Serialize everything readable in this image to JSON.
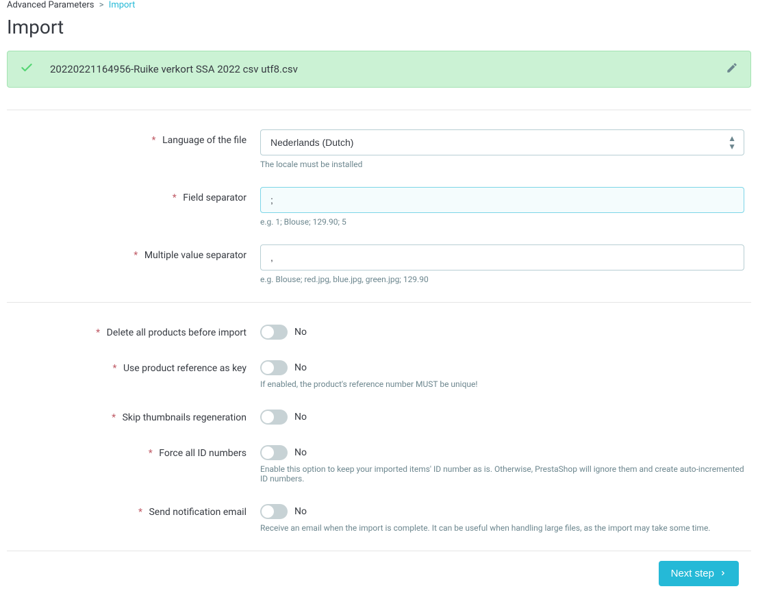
{
  "breadcrumb": {
    "parent": "Advanced Parameters",
    "current": "Import"
  },
  "page_title": "Import",
  "file": {
    "name": "20220221164956-Ruike verkort SSA 2022 csv utf8.csv"
  },
  "form": {
    "language": {
      "label": "Language of the file",
      "value": "Nederlands (Dutch)",
      "help": "The locale must be installed"
    },
    "field_separator": {
      "label": "Field separator",
      "value": ";",
      "help": "e.g. 1; Blouse; 129.90; 5"
    },
    "multi_separator": {
      "label": "Multiple value separator",
      "value": ",",
      "help": "e.g. Blouse; red.jpg, blue.jpg, green.jpg; 129.90"
    },
    "delete_products": {
      "label": "Delete all products before import",
      "state": "No"
    },
    "use_reference": {
      "label": "Use product reference as key",
      "state": "No",
      "help": "If enabled, the product's reference number MUST be unique!"
    },
    "skip_thumbnails": {
      "label": "Skip thumbnails regeneration",
      "state": "No"
    },
    "force_ids": {
      "label": "Force all ID numbers",
      "state": "No",
      "help": "Enable this option to keep your imported items' ID number as is. Otherwise, PrestaShop will ignore them and create auto-incremented ID numbers."
    },
    "send_email": {
      "label": "Send notification email",
      "state": "No",
      "help": "Receive an email when the import is complete. It can be useful when handling large files, as the import may take some time."
    }
  },
  "footer": {
    "next": "Next step"
  }
}
